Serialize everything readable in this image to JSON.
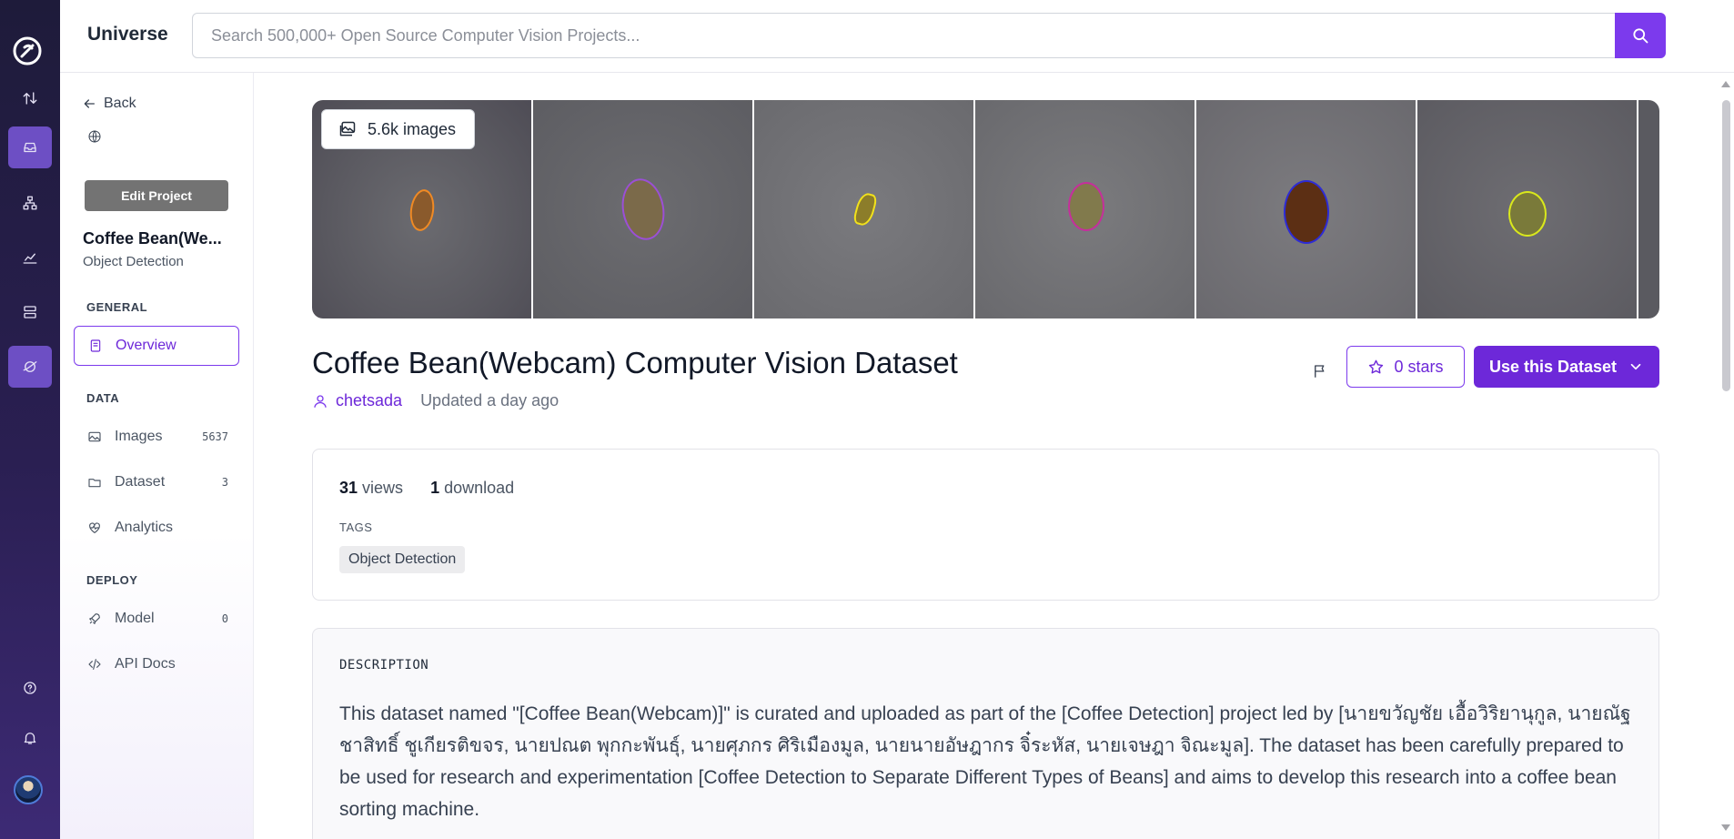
{
  "app": {
    "brand": "Universe"
  },
  "search": {
    "placeholder": "Search 500,000+ Open Source Computer Vision Projects..."
  },
  "rail": {
    "icons": [
      "roboflow-logo-icon",
      "upload-download-icon",
      "inbox-icon",
      "workflow-icon",
      "analytics-icon",
      "deploy-icon",
      "universe-icon",
      "help-icon",
      "bell-icon",
      "user-avatar"
    ]
  },
  "sidebar": {
    "back_label": "Back",
    "edit_label": "Edit Project",
    "project_name": "Coffee Bean(We...",
    "project_type": "Object Detection",
    "sections": {
      "general": "GENERAL",
      "data": "DATA",
      "deploy": "DEPLOY"
    },
    "items": {
      "overview": {
        "label": "Overview"
      },
      "images": {
        "label": "Images",
        "count": "5637"
      },
      "dataset": {
        "label": "Dataset",
        "count": "3"
      },
      "analytics": {
        "label": "Analytics"
      },
      "model": {
        "label": "Model",
        "count": "0"
      },
      "api_docs": {
        "label": "API Docs"
      }
    }
  },
  "main": {
    "image_count": "5.6k images",
    "title": "Coffee Bean(Webcam) Computer Vision Dataset",
    "author": "chetsada",
    "updated": "Updated a day ago",
    "stars_label": "0 stars",
    "use_label": "Use this Dataset",
    "stats": {
      "views_num": "31",
      "views_label": "views",
      "downloads_num": "1",
      "downloads_label": "download"
    },
    "tags_label": "TAGS",
    "tags": [
      "Object Detection"
    ],
    "description_label": "DESCRIPTION",
    "description": "This dataset named \"[Coffee Bean(Webcam)]\" is curated and uploaded as part of the [Coffee Detection] project led by [นายขวัญชัย เอื้อวิริยานุกูล, นายณัฐชาสิทธิ์ ชูเกียรติขจร, นายปณต พุกกะพันธุ์, นายศุภกร ศิริเมืองมูล, นายนายอัษฎากร จิ๋ระหัส, นายเจษฎา จิณะมูล]. The dataset has been carefully prepared to be used for research and experimentation [Coffee Detection to Separate Different Types of Beans] and aims to develop this research into a coffee bean sorting machine."
  },
  "colors": {
    "accent": "#6d28d9",
    "rail_bg": "#231c45",
    "bean_outlines": [
      "#e8822a",
      "#9b4fd6",
      "#f2e21b",
      "#c52f9c",
      "#2d2bd6",
      "#d9e81c"
    ]
  }
}
